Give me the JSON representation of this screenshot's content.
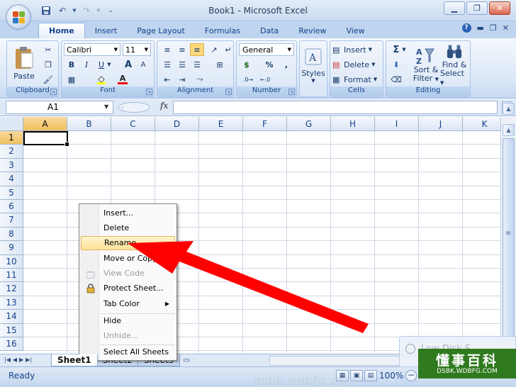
{
  "window": {
    "title": "Book1 - Microsoft Excel"
  },
  "ribbon": {
    "tabs": [
      "Home",
      "Insert",
      "Page Layout",
      "Formulas",
      "Data",
      "Review",
      "View"
    ],
    "active_tab": "Home",
    "clipboard": {
      "label": "Clipboard",
      "paste": "Paste"
    },
    "font": {
      "label": "Font",
      "name": "Calibri",
      "size": "11",
      "bold": "B",
      "italic": "I",
      "underline": "U",
      "grow": "A",
      "shrink": "A",
      "font_color": "A"
    },
    "alignment": {
      "label": "Alignment"
    },
    "number": {
      "label": "Number",
      "format": "General",
      "currency": "$",
      "percent": "%",
      "comma": ","
    },
    "styles": {
      "label": "Styles"
    },
    "cells": {
      "label": "Cells",
      "insert": "Insert",
      "delete": "Delete",
      "format": "Format"
    },
    "editing": {
      "label": "Editing",
      "sum": "Σ",
      "sort_filter_1": "Sort &",
      "sort_filter_2": "Filter",
      "find_select_1": "Find &",
      "find_select_2": "Select"
    }
  },
  "formula_bar": {
    "name_box": "A1",
    "fx": "fx"
  },
  "grid": {
    "columns": [
      "A",
      "B",
      "C",
      "D",
      "E",
      "F",
      "G",
      "H",
      "I",
      "J",
      "K"
    ],
    "rows": [
      "1",
      "2",
      "3",
      "4",
      "5",
      "6",
      "7",
      "8",
      "9",
      "10",
      "11",
      "12",
      "13",
      "14",
      "15",
      "16"
    ],
    "active_cell": "A1"
  },
  "context_menu": {
    "items": [
      {
        "label": "Insert...",
        "enabled": true
      },
      {
        "label": "Delete",
        "enabled": true
      },
      {
        "label": "Rename",
        "enabled": true,
        "highlighted": true
      },
      {
        "label": "Move or Copy...",
        "enabled": true
      },
      {
        "label": "View Code",
        "enabled": false
      },
      {
        "label": "Protect Sheet...",
        "enabled": true
      },
      {
        "label": "Tab Color",
        "enabled": true,
        "submenu": true
      },
      {
        "label": "Hide",
        "enabled": true
      },
      {
        "label": "Unhide...",
        "enabled": false
      },
      {
        "label": "Select All Sheets",
        "enabled": true
      }
    ]
  },
  "sheet_tabs": [
    "Sheet1",
    "Sheet2",
    "Sheet3"
  ],
  "active_sheet": "Sheet1",
  "status_bar": {
    "status": "Ready",
    "zoom": "100%"
  },
  "notification": {
    "text": "Low Disk S"
  },
  "watermark": {
    "main": "懂事百科",
    "sub": "DSBK.WDBFG.COM",
    "url": "dsbk.wdbfg.com"
  },
  "colors": {
    "arrow": "#ff0000",
    "menu_highlight": "#fde198",
    "selected_header": "#f1c15f"
  }
}
